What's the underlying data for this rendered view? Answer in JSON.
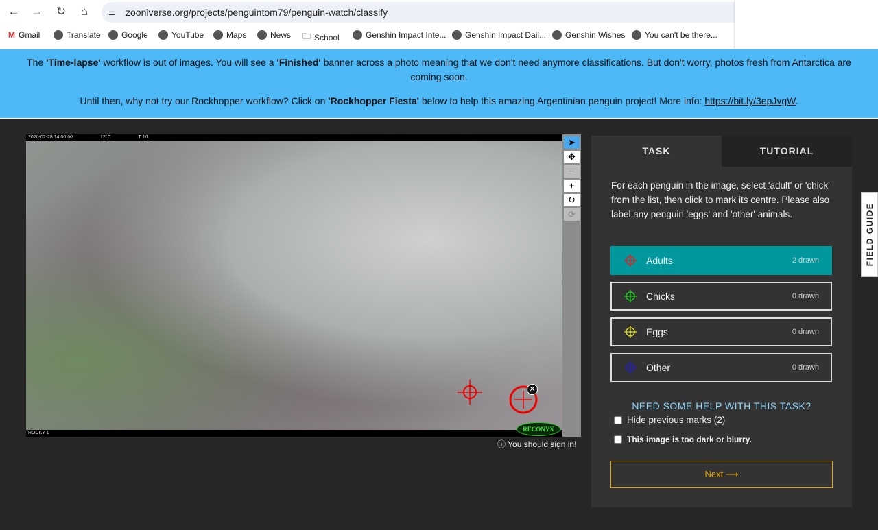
{
  "browser": {
    "url": "zooniverse.org/projects/penguintom79/penguin-watch/classify",
    "bookmarks": [
      "Gmail",
      "Translate",
      "Google",
      "YouTube",
      "Maps",
      "News",
      "School",
      "Genshin Impact Inte...",
      "Genshin Impact Dail...",
      "Genshin Wishes",
      "You can't be there..."
    ]
  },
  "banner": {
    "l1a": "The ",
    "l1b": "'Time-lapse'",
    "l1c": " workflow is out of images. You will see a ",
    "l1d": "'Finished'",
    "l1e": " banner across a photo meaning that we don't need anymore classifications. But don't worry, photos fresh from Antarctica are coming soon.",
    "l2a": "Until then, why not try our Rockhopper workflow? Click on ",
    "l2b": "'Rockhopper Fiesta'",
    "l2c": " below to help this amazing Argentinian penguin project! More info: ",
    "link": "https://bit.ly/3epJvgW",
    "l2d": "."
  },
  "image": {
    "date": "2020-02-28 14:00:00",
    "temp": "12°C",
    "trigger": "T 1/1",
    "camera": "ROCKY 1",
    "brand": "RECONYX"
  },
  "sign_in": "You should sign in!",
  "panel": {
    "tabs": [
      "TASK",
      "TUTORIAL"
    ],
    "instructions": "For each penguin in the image, select 'adult' or 'chick' from the list, then click to mark its centre. Please also label any penguin 'eggs' and 'other' animals.",
    "options": [
      {
        "label": "Adults",
        "count": "2 drawn",
        "color": "#e02020"
      },
      {
        "label": "Chicks",
        "count": "0 drawn",
        "color": "#22cc22"
      },
      {
        "label": "Eggs",
        "count": "0 drawn",
        "color": "#dddd22"
      },
      {
        "label": "Other",
        "count": "0 drawn",
        "color": "#2222bb"
      }
    ],
    "help": "NEED SOME HELP WITH THIS TASK?",
    "hide_marks": "Hide previous marks (2)",
    "too_dark": "This image is too dark or blurry.",
    "next": "Next ⟶"
  },
  "field_guide": "FIELD GUIDE"
}
